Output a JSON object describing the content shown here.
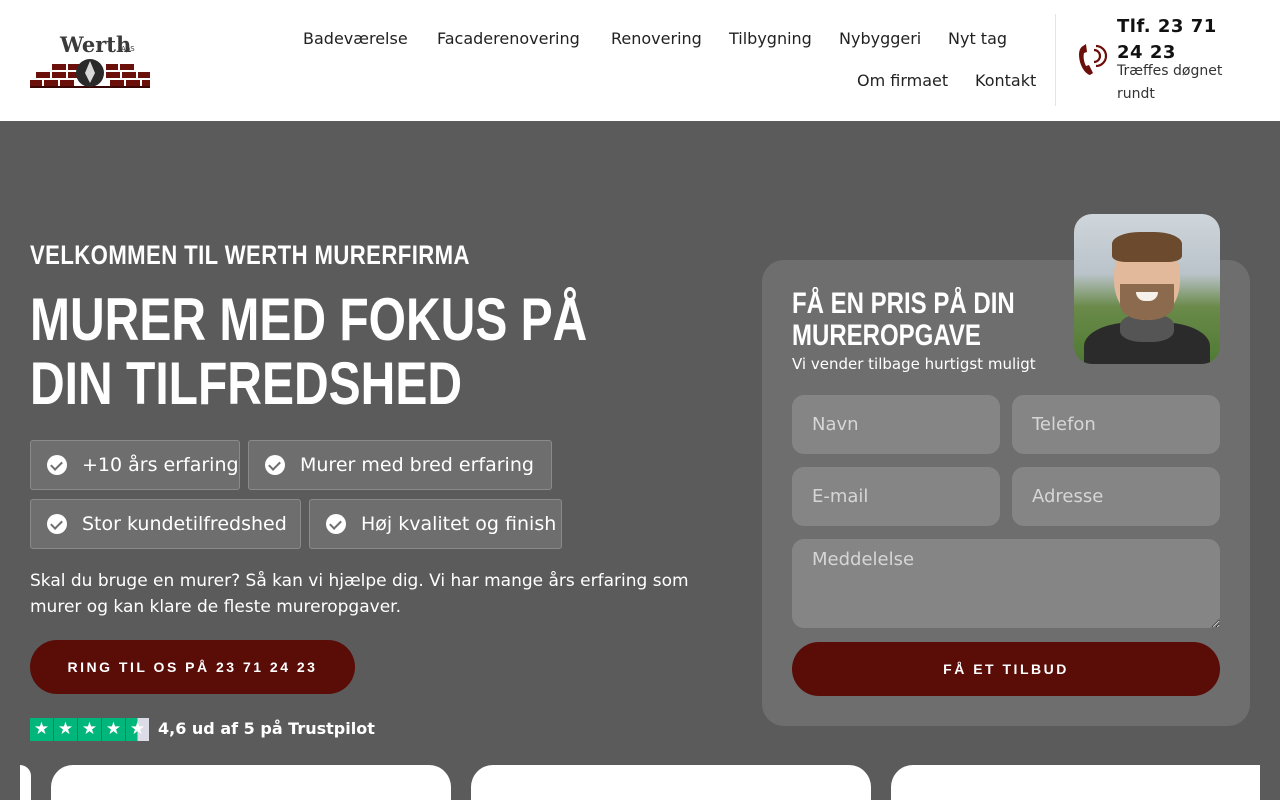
{
  "header": {
    "logo": {
      "name": "Werth",
      "suffix": "ApS"
    },
    "nav": [
      {
        "label": "Badeværelse"
      },
      {
        "label": "Facaderenovering"
      },
      {
        "label": "Renovering"
      },
      {
        "label": "Tilbygning"
      },
      {
        "label": "Nybyggeri"
      },
      {
        "label": "Nyt tag"
      },
      {
        "label": "Om firmaet"
      },
      {
        "label": "Kontakt"
      }
    ],
    "phone": {
      "title": "Tlf. 23 71 24 23",
      "subtitle": "Træffes døgnet rundt",
      "icon": "phone-icon"
    }
  },
  "hero": {
    "eyebrow": "VELKOMMEN TIL WERTH MURERFIRMA",
    "title": "MURER MED FOKUS PÅ DIN TILFREDSHED",
    "features": [
      {
        "label": "+10 års erfaring",
        "icon": "check-circle-icon"
      },
      {
        "label": "Murer med bred erfaring",
        "icon": "check-circle-icon"
      },
      {
        "label": "Stor kundetilfredshed",
        "icon": "check-circle-icon"
      },
      {
        "label": "Høj kvalitet og finish",
        "icon": "check-circle-icon"
      }
    ],
    "intro": "Skal du bruge en murer? Så kan vi hjælpe dig. Vi har mange års erfaring som murer og kan klare de fleste mureropgaver.",
    "cta_label": "RING TIL OS PÅ 23 71 24 23",
    "trustpilot": {
      "rating": 4.6,
      "stars_shown": 5,
      "text": "4,6 ud af 5 på Trustpilot"
    }
  },
  "form": {
    "title": "FÅ EN PRIS PÅ DIN MUREROPGAVE",
    "subtitle": "Vi vender tilbage hurtigst muligt",
    "fields": {
      "name": {
        "placeholder": "Navn",
        "value": ""
      },
      "phone": {
        "placeholder": "Telefon",
        "value": ""
      },
      "email": {
        "placeholder": "E-mail",
        "value": ""
      },
      "address": {
        "placeholder": "Adresse",
        "value": ""
      },
      "message": {
        "placeholder": "Meddelelse",
        "value": ""
      }
    },
    "submit_label": "FÅ ET TILBUD"
  },
  "colors": {
    "brand": "#5a0c07",
    "hero_bg": "#5b5b5b",
    "card_bg": "#6e6e6e",
    "trustpilot_green": "#00b67a"
  }
}
